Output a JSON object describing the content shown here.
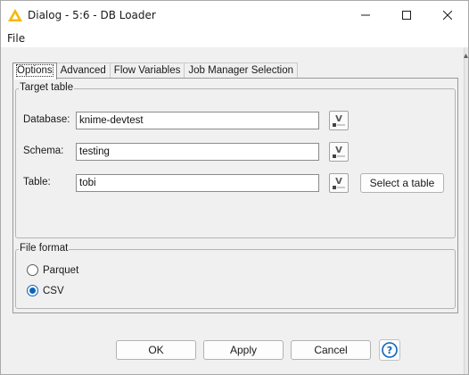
{
  "window": {
    "title": "Dialog - 5:6 - DB Loader",
    "app_icon": "knime-triangle-icon",
    "controls": [
      "minimize-icon",
      "maximize-icon",
      "close-icon"
    ]
  },
  "menubar": {
    "items": [
      {
        "label": "File"
      }
    ]
  },
  "tabs": [
    {
      "label": "Options",
      "active": true
    },
    {
      "label": "Advanced",
      "active": false
    },
    {
      "label": "Flow Variables",
      "active": false
    },
    {
      "label": "Job Manager Selection",
      "active": false
    }
  ],
  "target_table": {
    "legend": "Target table",
    "database": {
      "label": "Database:",
      "value": "knime-devtest"
    },
    "schema": {
      "label": "Schema:",
      "value": "testing"
    },
    "table": {
      "label": "Table:",
      "value": "tobi"
    },
    "select_table_button": "Select a table"
  },
  "file_format": {
    "legend": "File format",
    "options": [
      {
        "label": "Parquet",
        "selected": false
      },
      {
        "label": "CSV",
        "selected": true
      }
    ]
  },
  "footer": {
    "ok": "OK",
    "apply": "Apply",
    "cancel": "Cancel",
    "help_icon": "help-icon"
  },
  "colors": {
    "accent": "#0a64b8",
    "knime_yellow": "#f5b800"
  }
}
